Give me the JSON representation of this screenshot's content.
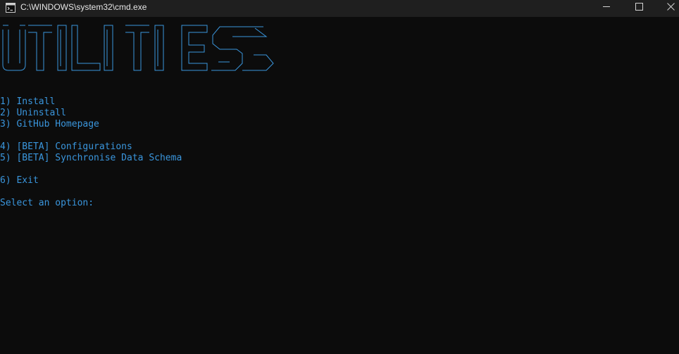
{
  "window": {
    "title": "C:\\WINDOWS\\system32\\cmd.exe",
    "icon": "cmd-console-icon",
    "controls": {
      "minimize": "minimize-icon",
      "maximize": "maximize-icon",
      "close": "close-icon"
    }
  },
  "colors": {
    "console_background": "#0c0c0c",
    "titlebar_background": "#1f1f1f",
    "console_text": "#3a96dd",
    "title_text": "#e6e6e6"
  },
  "banner": {
    "text": "UTILITIES",
    "style": "ascii-art"
  },
  "menu": {
    "items": [
      "1) Install",
      "2) Uninstall",
      "3) GitHub Homepage",
      "4) [BETA] Configurations",
      "5) [BETA] Synchronise Data Schema",
      "6) Exit"
    ],
    "prompt": "Select an option: "
  }
}
